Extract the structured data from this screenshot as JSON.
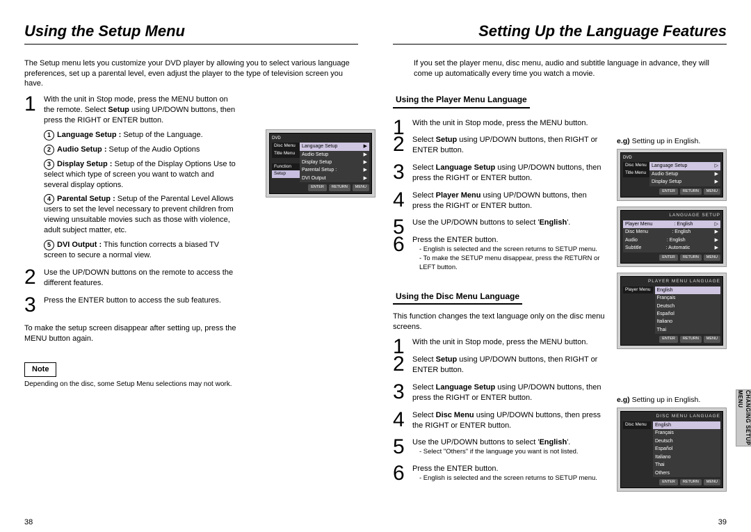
{
  "left": {
    "heading": "Using the Setup Menu",
    "intro": "The Setup menu lets you customize your DVD player by allowing you to select various language preferences, set up a parental level, even adjust the player to the type of television screen you have.",
    "steps": [
      {
        "main_pre": "With the unit in Stop mode, press the MENU button on the remote. Select ",
        "main_bold": "Setup",
        "main_post": " using UP/DOWN buttons, then press the RIGHT or ENTER button.",
        "subs": [
          {
            "n": "1",
            "bold": "Language Setup :",
            "rest": " Setup of the Language."
          },
          {
            "n": "2",
            "bold": "Audio Setup :",
            "rest": " Setup of the Audio Options"
          },
          {
            "n": "3",
            "bold": "Display Setup :",
            "rest": " Setup of the Display Options Use to select which type of screen you want to watch and several display options."
          },
          {
            "n": "4",
            "bold": "Parental Setup :",
            "rest": " Setup of the Parental Level Allows users to set the level necessary to prevent children from viewing unsuitable movies such as those with violence, adult subject matter, etc."
          },
          {
            "n": "5",
            "bold": "DVI Output :",
            "rest": " This function corrects a biased TV screen to secure a normal view."
          }
        ]
      },
      {
        "main_plain": "Use the UP/DOWN buttons on the remote to access the different features."
      },
      {
        "main_plain": "Press the ENTER button to access the sub features."
      }
    ],
    "closing": "To make the setup screen disappear after setting up, press the MENU button again.",
    "note_label": "Note",
    "note_text": "Depending on the disc, some Setup Menu selections may not work.",
    "page": "38",
    "osd": {
      "header": "DVD",
      "tabs": [
        "Disc Menu",
        "Title Menu",
        "Function",
        "Setup"
      ],
      "items": [
        {
          "label": "Language Setup",
          "hl": true
        },
        {
          "label": "Audio Setup"
        },
        {
          "label": "Display Setup"
        },
        {
          "label": "Parental Setup :"
        },
        {
          "label": "DVI Output"
        }
      ],
      "footer": [
        "ENTER",
        "RETURN",
        "MENU"
      ]
    }
  },
  "right": {
    "heading": "Setting Up the Language Features",
    "intro": "If you set the player menu, disc menu, audio and subtitle language in advance, they will come up automatically every time you watch a movie.",
    "sectionA": {
      "title": "Using the Player Menu Language",
      "steps": [
        {
          "plain": "With the unit in Stop mode, press the MENU button."
        },
        {
          "pre": "Select ",
          "bold": "Setup",
          "post": " using UP/DOWN buttons, then RIGHT or ENTER button."
        },
        {
          "pre": "Select ",
          "bold": "Language Setup",
          "post": " using UP/DOWN buttons, then press the RIGHT or ENTER button."
        },
        {
          "pre": "Select ",
          "bold": "Player Menu",
          "post": " using UP/DOWN buttons, then press the RIGHT or ENTER button."
        },
        {
          "pre": "Use the UP/DOWN buttons to select '",
          "bold": "English",
          "post": "'."
        },
        {
          "plain": "Press the ENTER button.",
          "notes": [
            "- English is selected and the screen returns to SETUP menu.",
            "- To make the SETUP menu disappear, press the RETURN or LEFT button."
          ]
        }
      ]
    },
    "sectionB": {
      "title": "Using the Disc Menu Language",
      "intro": "This function changes the text language only on the disc menu screens.",
      "steps": [
        {
          "plain": "With the unit in Stop mode, press the MENU button."
        },
        {
          "pre": "Select ",
          "bold": "Setup",
          "post": " using UP/DOWN buttons, then RIGHT or ENTER button."
        },
        {
          "pre": "Select ",
          "bold": "Language Setup",
          "post": " using UP/DOWN buttons, then press the RIGHT or ENTER button."
        },
        {
          "pre": "Select ",
          "bold": "Disc Menu",
          "post": " using UP/DOWN buttons, then press the RIGHT or ENTER button."
        },
        {
          "pre": "Use the UP/DOWN buttons to select '",
          "bold": "English",
          "post": "'.",
          "notes": [
            "- Select \"Others\" if the language you want is not listed."
          ]
        },
        {
          "plain": "Press the ENTER button.",
          "notes": [
            "- English is selected and the screen returns to SETUP menu."
          ]
        }
      ]
    },
    "egA": "e.g) Setting up in English.",
    "egB": "e.g) Setting up in English.",
    "page": "39",
    "tab": "CHANGING SETUP MENU",
    "osdA": [
      {
        "header": "DVD",
        "tabs": [
          "Disc Menu",
          "Title Menu"
        ],
        "items": [
          {
            "label": "Language Setup",
            "hl": true
          },
          {
            "label": "Audio Setup"
          },
          {
            "label": "Display Setup"
          }
        ],
        "footer": [
          "ENTER",
          "RETURN",
          "MENU"
        ]
      },
      {
        "title": "LANGUAGE SETUP",
        "rows": [
          [
            "Player Menu",
            ": English",
            true
          ],
          [
            "Disc Menu",
            ": English"
          ],
          [
            "Audio",
            ": English"
          ],
          [
            "Subtitle",
            ": Automatic"
          ]
        ],
        "footer": [
          "ENTER",
          "RETURN",
          "MENU"
        ]
      },
      {
        "title": "PLAYER MENU LANGUAGE",
        "items": [
          "English",
          "Français",
          "Deutsch",
          "Español",
          "Italiano",
          "Thai"
        ],
        "left": "Player Menu",
        "footer": [
          "ENTER",
          "RETURN",
          "MENU"
        ]
      }
    ],
    "osdB": {
      "title": "DISC MENU LANGUAGE",
      "items": [
        "English",
        "Français",
        "Deutsch",
        "Español",
        "Italiano",
        "Thai",
        "Others"
      ],
      "left": "Disc Menu",
      "footer": [
        "ENTER",
        "RETURN",
        "MENU"
      ]
    }
  }
}
